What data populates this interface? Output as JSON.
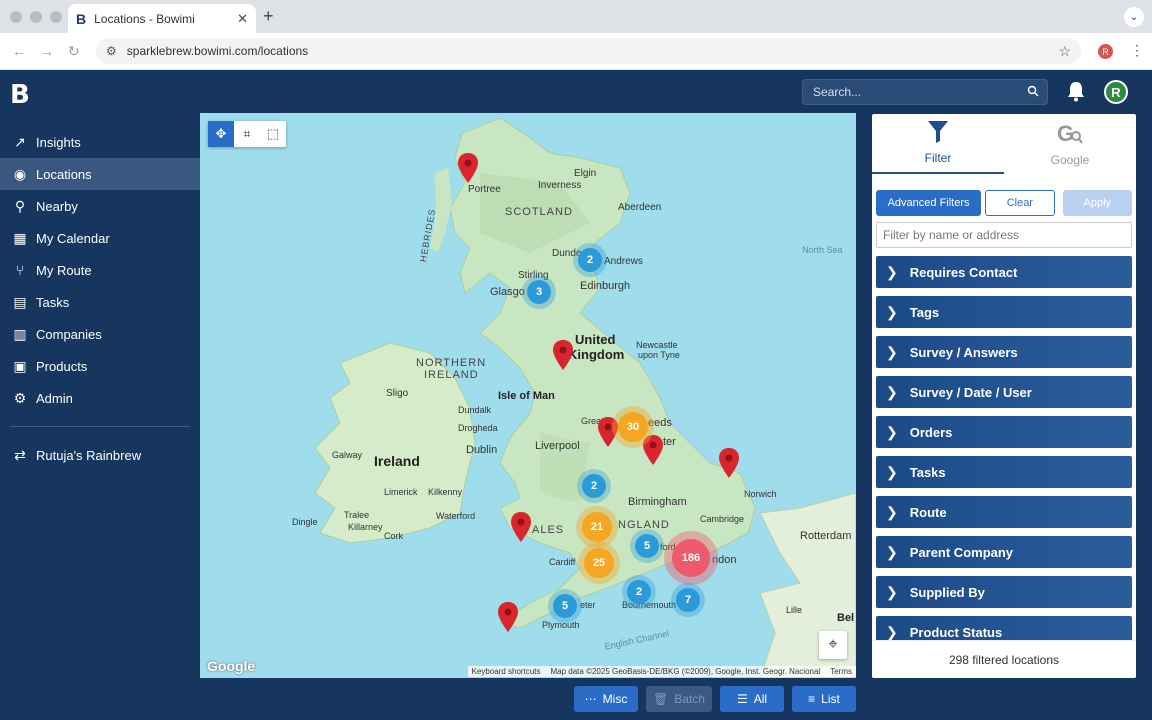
{
  "browser": {
    "tab_title": "Locations - Bowimi",
    "tab_favicon": "B",
    "url": "sparklebrew.bowimi.com/locations",
    "profile_initial": "R"
  },
  "header": {
    "logo": "B",
    "search_placeholder": "Search...",
    "user_initial": "R"
  },
  "sidebar": {
    "items": [
      {
        "label": "Insights",
        "icon": "chart-line-icon"
      },
      {
        "label": "Locations",
        "icon": "globe-icon",
        "active": true
      },
      {
        "label": "Nearby",
        "icon": "map-pin-icon"
      },
      {
        "label": "My Calendar",
        "icon": "calendar-icon"
      },
      {
        "label": "My Route",
        "icon": "route-icon"
      },
      {
        "label": "Tasks",
        "icon": "tasks-icon"
      },
      {
        "label": "Companies",
        "icon": "building-icon"
      },
      {
        "label": "Products",
        "icon": "book-icon"
      },
      {
        "label": "Admin",
        "icon": "gear-icon"
      }
    ],
    "account": {
      "label": "Rutuja's Rainbrew",
      "icon": "swap-icon"
    }
  },
  "map": {
    "labels": {
      "elgin": "Elgin",
      "inverness": "Inverness",
      "aberdeen": "Aberdeen",
      "portree": "Portree",
      "scotland": "SCOTLAND",
      "hebrides": "HEBRIDES",
      "dundee": "Dundee",
      "andrews": "Andrews",
      "north_sea": "North Sea",
      "stirling": "Stirling",
      "glasgow": "Glasgo",
      "edinburgh": "Edinburgh",
      "uk1": "United",
      "uk2": "Kingdom",
      "newcastle1": "Newcastle",
      "newcastle2": "upon Tyne",
      "ni1": "NORTHERN",
      "ni2": "IRELAND",
      "sligo": "Sligo",
      "isle_of_man": "Isle of Man",
      "dundalk": "Dundalk",
      "drogheda": "Drogheda",
      "ireland": "Ireland",
      "dublin": "Dublin",
      "galway": "Galway",
      "liverpool": "Liverpool",
      "leeds": "eeds",
      "greater": "Great",
      "manchester": "ter",
      "limerick": "Limerick",
      "kilkenny": "Kilkenny",
      "birmingham": "Birmingham",
      "norwich": "Norwich",
      "tralee": "Tralee",
      "killarney": "Killarney",
      "waterford": "Waterford",
      "dingle": "Dingle",
      "cork": "Cork",
      "wales": "ALES",
      "england": "NGLAND",
      "cambridge": "Cambridge",
      "cardiff": "Cardiff",
      "oxford": "ford",
      "london": "ndon",
      "rotterdam": "Rotterdam",
      "exeter": "eter",
      "bournemouth": "Bournemouth",
      "plymouth": "Plymouth",
      "lille": "Lille",
      "channel": "English Channel",
      "bel": "Bel"
    },
    "clusters": [
      "2",
      "3",
      "30",
      "2",
      "21",
      "5",
      "186",
      "25",
      "2",
      "7",
      "5"
    ],
    "attribution": {
      "shortcuts": "Keyboard shortcuts",
      "data": "Map data ©2025 GeoBasis-DE/BKG (©2009), Google, Inst. Geogr. Nacional",
      "terms": "Terms"
    },
    "google": "Google"
  },
  "panel": {
    "tabs": [
      {
        "label": "Filter",
        "icon": "funnel-icon",
        "active": true
      },
      {
        "label": "Google",
        "icon": "google-search-icon"
      }
    ],
    "buttons": {
      "advanced": "Advanced Filters",
      "clear": "Clear",
      "apply": "Apply"
    },
    "filter_placeholder": "Filter by name or address",
    "sections": [
      "Requires Contact",
      "Tags",
      "Survey / Answers",
      "Survey / Date / User",
      "Orders",
      "Tasks",
      "Route",
      "Parent Company",
      "Supplied By",
      "Product Status"
    ],
    "footer": "298 filtered locations"
  },
  "bottom_buttons": {
    "misc": "Misc",
    "batch": "Batch",
    "all": "All",
    "list": "List"
  }
}
